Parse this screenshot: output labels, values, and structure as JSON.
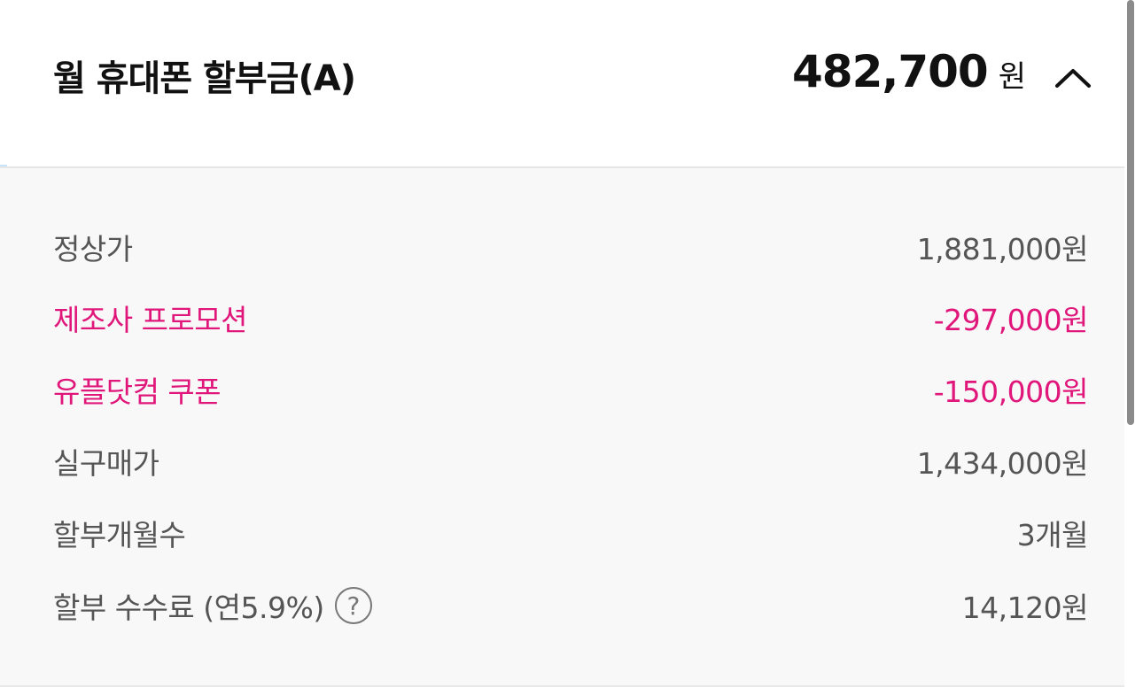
{
  "header": {
    "title": "월 휴대폰 할부금(A)",
    "total_amount": "482,700",
    "total_unit": "원",
    "toggle_icon": "chevron-up-icon"
  },
  "details": {
    "rows": [
      {
        "label": "정상가",
        "value": "1,881,000원",
        "type": "normal"
      },
      {
        "label": "제조사 프로모션",
        "value": "-297,000원",
        "type": "discount"
      },
      {
        "label": "유플닷컴 쿠폰",
        "value": "-150,000원",
        "type": "discount"
      },
      {
        "label": "실구매가",
        "value": "1,434,000원",
        "type": "normal"
      },
      {
        "label": "할부개월수",
        "value": "3개월",
        "type": "normal"
      },
      {
        "label": "할부 수수료 (연5.9%)",
        "value": "14,120원",
        "type": "normal"
      }
    ],
    "help_icon_text": "?"
  },
  "colors": {
    "text_primary": "#111111",
    "text_secondary": "#555555",
    "discount": "#e0167a",
    "panel_bg": "#f8f8f8"
  }
}
